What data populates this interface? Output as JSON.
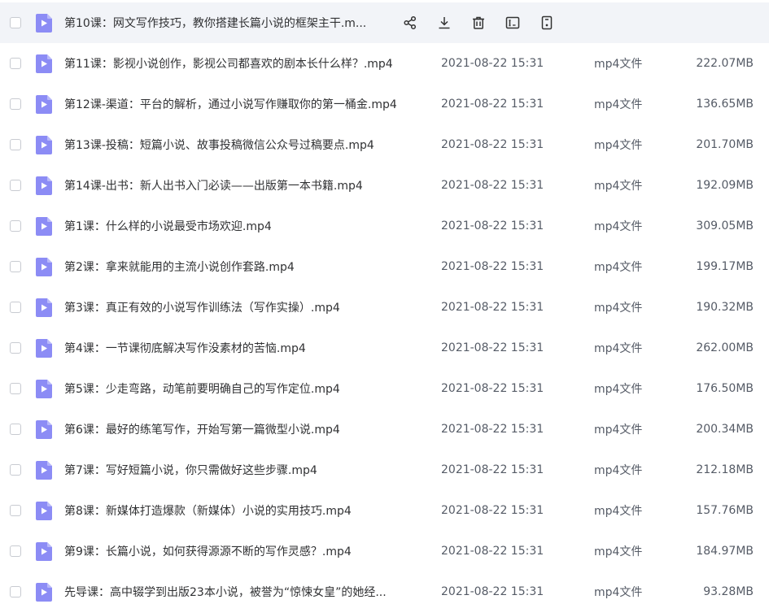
{
  "toolbar": {
    "share": "share-icon",
    "download": "download-icon",
    "delete": "trash-icon",
    "rename": "rename-icon",
    "more": "more-icon"
  },
  "colors": {
    "file_icon": "#8c8cf5",
    "hover_row": "#f2f4f8"
  },
  "files": [
    {
      "name": "第10课：网文写作技巧，教你搭建长篇小说的框架主干.m...",
      "date": "",
      "type": "",
      "size": "",
      "hovered": true
    },
    {
      "name": "第11课：影视小说创作，影视公司都喜欢的剧本长什么样？.mp4",
      "date": "2021-08-22 15:31",
      "type": "mp4文件",
      "size": "222.07MB"
    },
    {
      "name": "第12课-渠道：平台的解析，通过小说写作赚取你的第一桶金.mp4",
      "date": "2021-08-22 15:31",
      "type": "mp4文件",
      "size": "136.65MB"
    },
    {
      "name": "第13课-投稿：短篇小说、故事投稿微信公众号过稿要点.mp4",
      "date": "2021-08-22 15:31",
      "type": "mp4文件",
      "size": "201.70MB"
    },
    {
      "name": "第14课-出书：新人出书入门必读——出版第一本书籍.mp4",
      "date": "2021-08-22 15:31",
      "type": "mp4文件",
      "size": "192.09MB"
    },
    {
      "name": "第1课：什么样的小说最受市场欢迎.mp4",
      "date": "2021-08-22 15:31",
      "type": "mp4文件",
      "size": "309.05MB"
    },
    {
      "name": "第2课：拿来就能用的主流小说创作套路.mp4",
      "date": "2021-08-22 15:31",
      "type": "mp4文件",
      "size": "199.17MB"
    },
    {
      "name": "第3课：真正有效的小说写作训练法（写作实操）.mp4",
      "date": "2021-08-22 15:31",
      "type": "mp4文件",
      "size": "190.32MB"
    },
    {
      "name": "第4课：一节课彻底解决写作没素材的苦恼.mp4",
      "date": "2021-08-22 15:31",
      "type": "mp4文件",
      "size": "262.00MB"
    },
    {
      "name": "第5课：少走弯路，动笔前要明确自己的写作定位.mp4",
      "date": "2021-08-22 15:31",
      "type": "mp4文件",
      "size": "176.50MB"
    },
    {
      "name": "第6课：最好的练笔写作，开始写第一篇微型小说.mp4",
      "date": "2021-08-22 15:31",
      "type": "mp4文件",
      "size": "200.34MB"
    },
    {
      "name": "第7课：写好短篇小说，你只需做好这些步骤.mp4",
      "date": "2021-08-22 15:31",
      "type": "mp4文件",
      "size": "212.18MB"
    },
    {
      "name": "第8课：新媒体打造爆款（新媒体）小说的实用技巧.mp4",
      "date": "2021-08-22 15:31",
      "type": "mp4文件",
      "size": "157.76MB"
    },
    {
      "name": "第9课：长篇小说，如何获得源源不断的写作灵感？.mp4",
      "date": "2021-08-22 15:31",
      "type": "mp4文件",
      "size": "184.97MB"
    },
    {
      "name": "先导课：高中辍学到出版23本小说，被誉为“惊悚女皇”的她经...",
      "date": "2021-08-22 15:31",
      "type": "mp4文件",
      "size": "93.28MB"
    }
  ]
}
